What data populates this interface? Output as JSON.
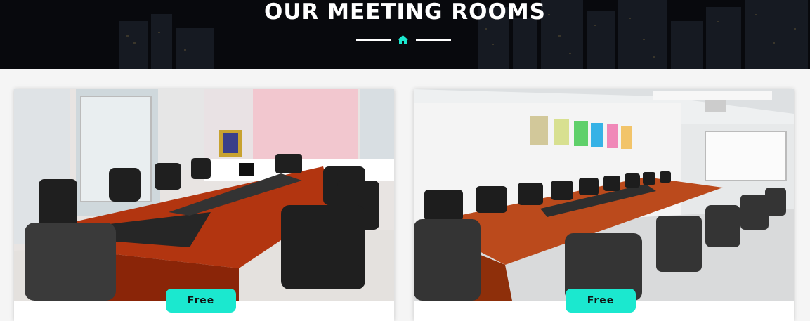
{
  "hero": {
    "title": "OUR MEETING ROOMS",
    "icon": "home-icon",
    "accent_color": "#1be8cf"
  },
  "rooms": [
    {
      "image_description_name": "meeting-room-photo-1",
      "badge_label": "Free"
    },
    {
      "image_description_name": "meeting-room-photo-2",
      "badge_label": "Free"
    }
  ]
}
